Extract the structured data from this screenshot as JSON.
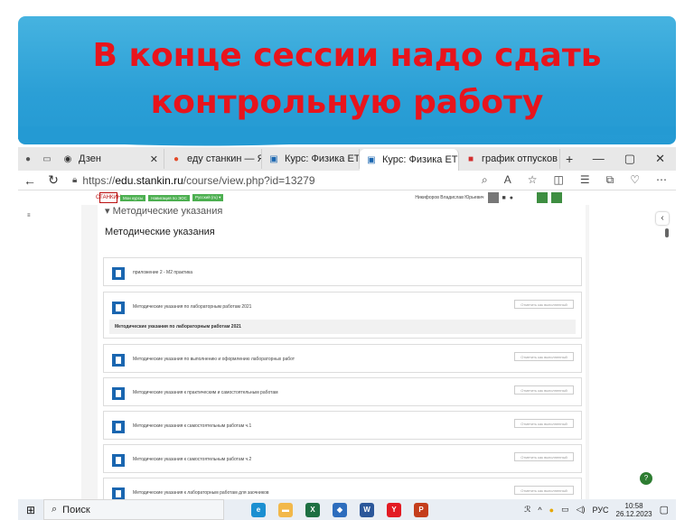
{
  "slide": {
    "title": "В конце сессии надо сдать контрольную работу"
  },
  "browser": {
    "tabs": [
      {
        "label": "Дзен",
        "icon": "globe-icon"
      },
      {
        "label": "еду станкин — Я",
        "icon": "yandex-icon"
      },
      {
        "label": "Курс: Физика ЕТК",
        "icon": "moodle-icon"
      },
      {
        "label": "Курс: Физика ЕТК",
        "icon": "moodle-icon",
        "active": true
      },
      {
        "label": "график отпусков",
        "icon": "pdf-icon"
      }
    ],
    "new_tab": "+",
    "url_scheme": "https://",
    "url_host": "edu.stankin.ru",
    "url_path": "/course/view.php?id=13279",
    "window_controls": [
      "—",
      "▢",
      "✕"
    ]
  },
  "site": {
    "logo_text": "СТАНКИН",
    "nav_buttons": [
      "Мои курсы",
      "Навигация по ЭОС",
      "Русский (ru) ▾"
    ],
    "user_name": "Никифоров Владислав Юрьевич"
  },
  "section": {
    "header": "▾ Методические указания",
    "title": "Методические указания",
    "mark_label": "Отметить как выполненный",
    "items": [
      {
        "label": "приложение 2 - М2 практика",
        "has_mark": false,
        "description": ""
      },
      {
        "label": "Методические указания по лабораторным работам 2021",
        "has_mark": true,
        "description": "Методические указания по лабораторным работам 2021"
      },
      {
        "label": "Методические указания по выполнению и оформлению лабораторных работ",
        "has_mark": true,
        "description": ""
      },
      {
        "label": "Методические указания к практическим и самостоятельным работам",
        "has_mark": true,
        "description": ""
      },
      {
        "label": "Методические указания к самостоятельным работам ч.1",
        "has_mark": true,
        "description": ""
      },
      {
        "label": "Методические указания к самостоятельным работам ч.2",
        "has_mark": true,
        "description": ""
      },
      {
        "label": "Методические указания к лабораторным работам для заочников",
        "has_mark": true,
        "description": ""
      }
    ]
  },
  "taskbar": {
    "search_label": "Поиск",
    "apps": [
      {
        "name": "edge",
        "glyph": "e",
        "color": "#1b8fd1"
      },
      {
        "name": "explorer",
        "glyph": "▬",
        "color": "#f2b84a"
      },
      {
        "name": "excel",
        "glyph": "X",
        "color": "#1d6f42"
      },
      {
        "name": "store",
        "glyph": "◆",
        "color": "#2d6dbd"
      },
      {
        "name": "word",
        "glyph": "W",
        "color": "#2b579a"
      },
      {
        "name": "yandex",
        "glyph": "Y",
        "color": "#e31b23"
      },
      {
        "name": "powerpoint",
        "glyph": "P",
        "color": "#c43e1c"
      }
    ],
    "lang": "РУС",
    "time": "10:58",
    "date": "26.12.2023"
  }
}
